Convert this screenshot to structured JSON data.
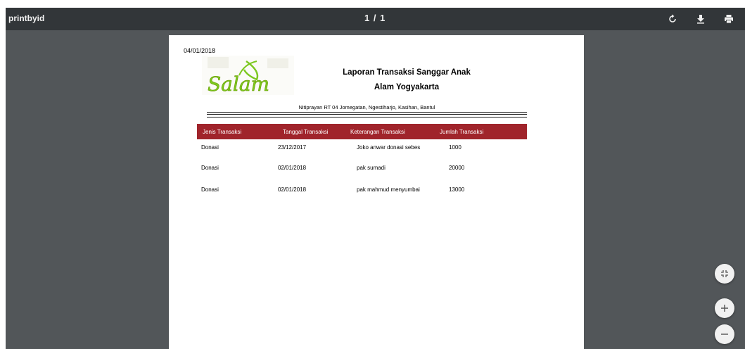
{
  "toolbar": {
    "title": "printbyid",
    "page_indicator": "1 / 1",
    "icons": [
      "rotate-icon",
      "download-icon",
      "print-icon"
    ]
  },
  "document": {
    "date": "04/01/2018",
    "logo_text": "Salam",
    "title_line1": "Laporan Transaksi Sanggar Anak",
    "title_line2": "Alam Yogyakarta",
    "address": "Nitiprayan RT 04 Jomegatan, Ngestiharjo, Kasihan, Bantul",
    "table": {
      "headers": [
        "Jenis Transaksi",
        "Tanggal Transaksi",
        "Keterangan Transaksi",
        "Jumlah Transaksi"
      ],
      "rows": [
        [
          "Donasi",
          "23/12/2017",
          "Joko anwar donasi sebes",
          "1000"
        ],
        [
          "Donasi",
          "02/01/2018",
          "pak sumadi",
          "20000"
        ],
        [
          "Donasi",
          "02/01/2018",
          "pak mahmud menyumbai",
          "13000"
        ]
      ]
    }
  },
  "zoom_controls": [
    "fit-page-icon",
    "zoom-in-icon",
    "zoom-out-icon"
  ],
  "colors": {
    "toolbar_bg": "#323639",
    "viewer_bg": "#525659",
    "table_header_bg": "#a0242b",
    "logo_green": "#7cc820"
  }
}
